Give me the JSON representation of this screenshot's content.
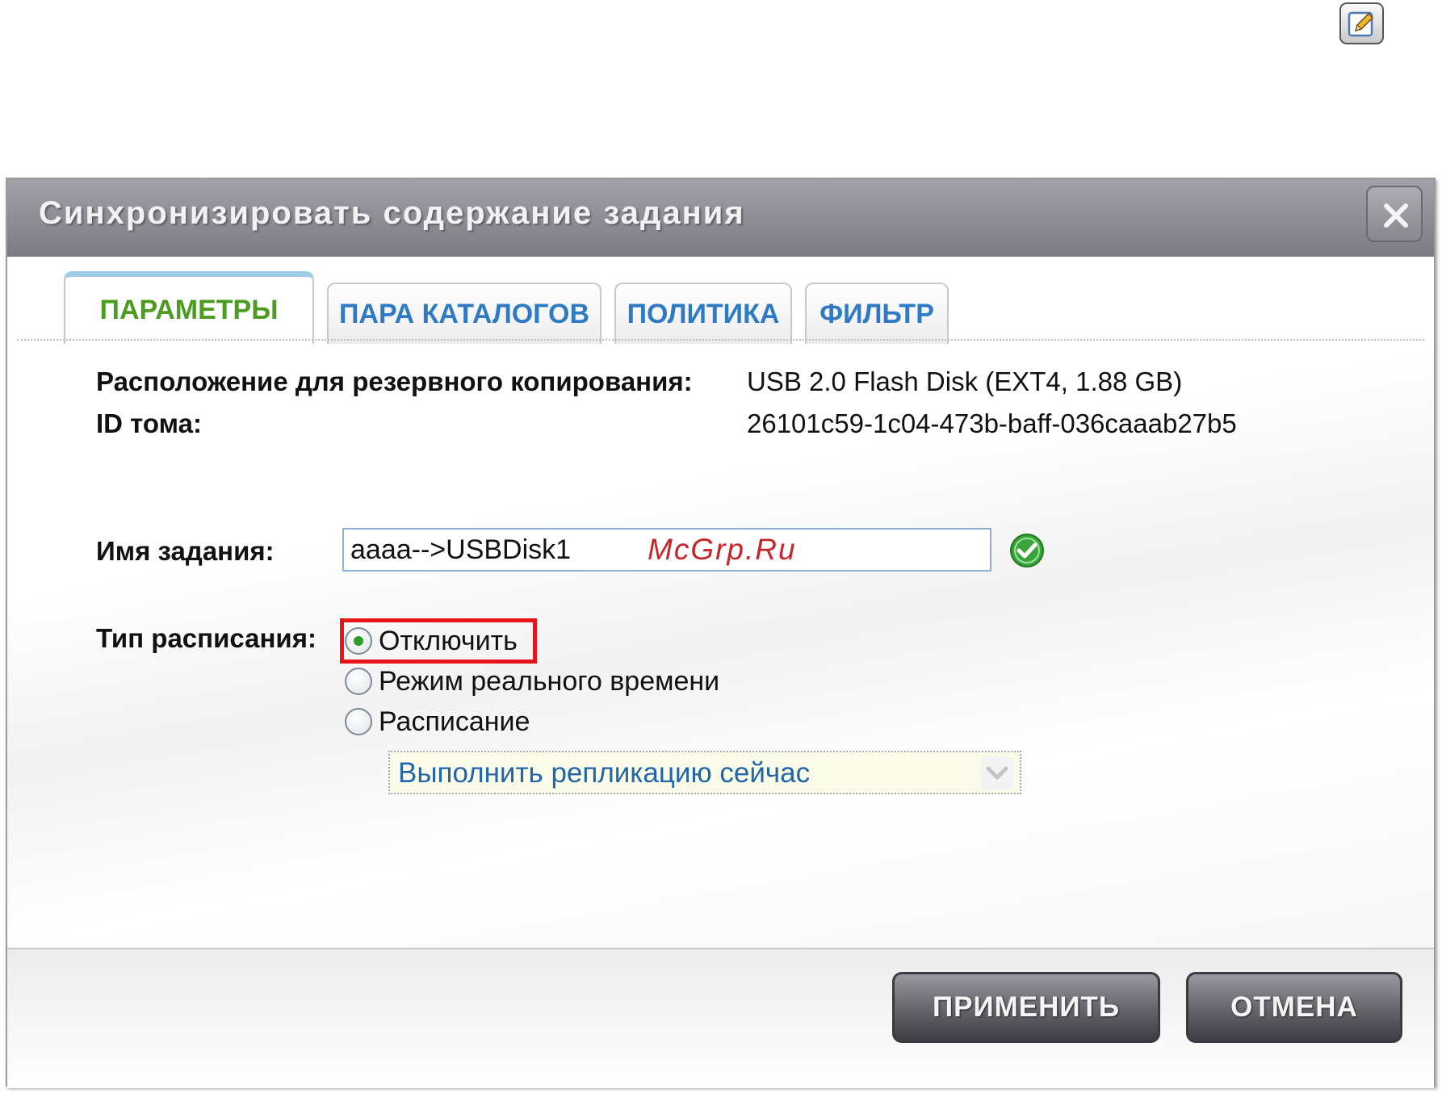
{
  "dialog": {
    "title": "Синхронизировать содержание задания"
  },
  "tabs": [
    {
      "label": "ПАРАМЕТРЫ",
      "active": true
    },
    {
      "label": "ПАРА КАТАЛОГОВ",
      "active": false
    },
    {
      "label": "ПОЛИТИКА",
      "active": false
    },
    {
      "label": "ФИЛЬТР",
      "active": false
    }
  ],
  "info": {
    "backup_location_label": "Расположение для резервного копирования:",
    "backup_location_value": "USB 2.0 Flash Disk (EXT4, 1.88 GB)",
    "volume_id_label": "ID тома:",
    "volume_id_value": "26101c59-1c04-473b-baff-036caaab27b5"
  },
  "task": {
    "label": "Имя задания:",
    "value": "aaaa-->USBDisk1"
  },
  "watermark": "McGrp.Ru",
  "schedule": {
    "label": "Тип расписания:",
    "options": [
      {
        "label": "Отключить",
        "checked": true
      },
      {
        "label": "Режим реального времени",
        "checked": false
      },
      {
        "label": "Расписание",
        "checked": false
      }
    ],
    "select_value": "Выполнить репликацию сейчас"
  },
  "buttons": {
    "apply": "ПРИМЕНИТЬ",
    "cancel": "ОТМЕНА"
  },
  "icons": {
    "edit": "pencil-edit-icon",
    "close": "close-icon",
    "valid": "check-circle-icon",
    "dropdown": "chevron-down-icon"
  },
  "colors": {
    "tab_active_text": "#4c9c22",
    "tab_text": "#2e7bc4",
    "highlight": "#e8141a",
    "watermark": "#c8252a",
    "select_text": "#2266aa"
  }
}
